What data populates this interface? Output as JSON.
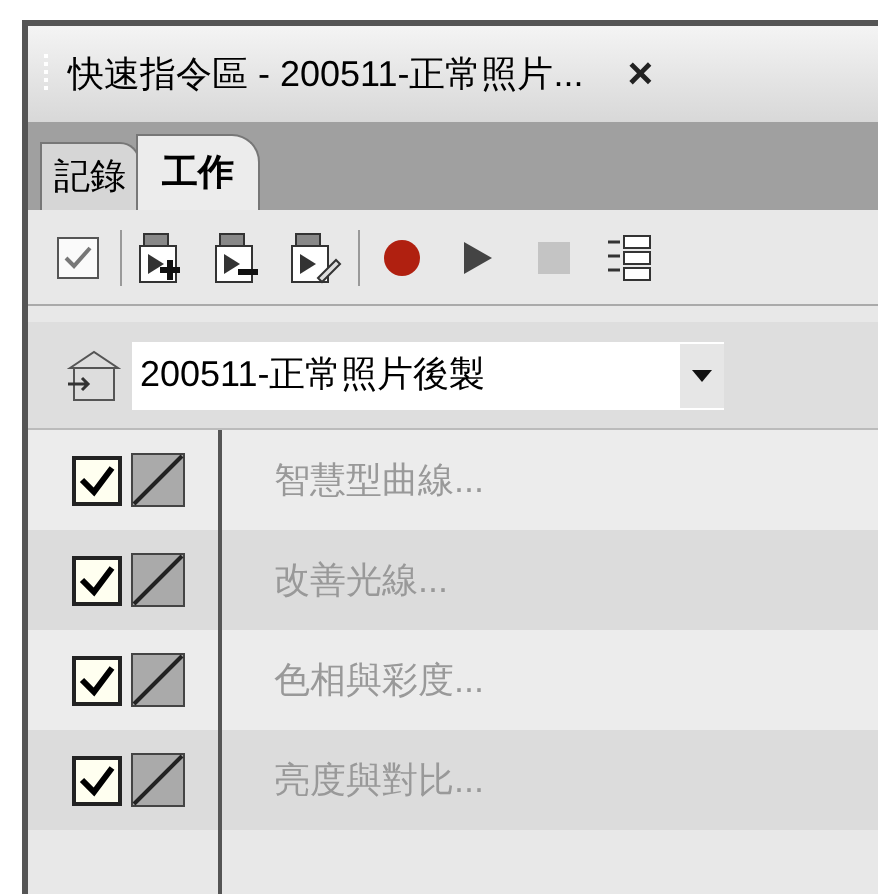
{
  "window": {
    "title": "快速指令區 - 200511-正常照片...",
    "close": "×"
  },
  "tabs": [
    {
      "label": "記錄",
      "selected": false
    },
    {
      "label": "工作",
      "selected": true
    }
  ],
  "action_set": {
    "value": "200511-正常照片後製"
  },
  "actions": [
    {
      "label": "智慧型曲線...",
      "checked": true
    },
    {
      "label": "改善光線...",
      "checked": true
    },
    {
      "label": "色相與彩度...",
      "checked": true
    },
    {
      "label": "亮度與對比...",
      "checked": true
    }
  ]
}
